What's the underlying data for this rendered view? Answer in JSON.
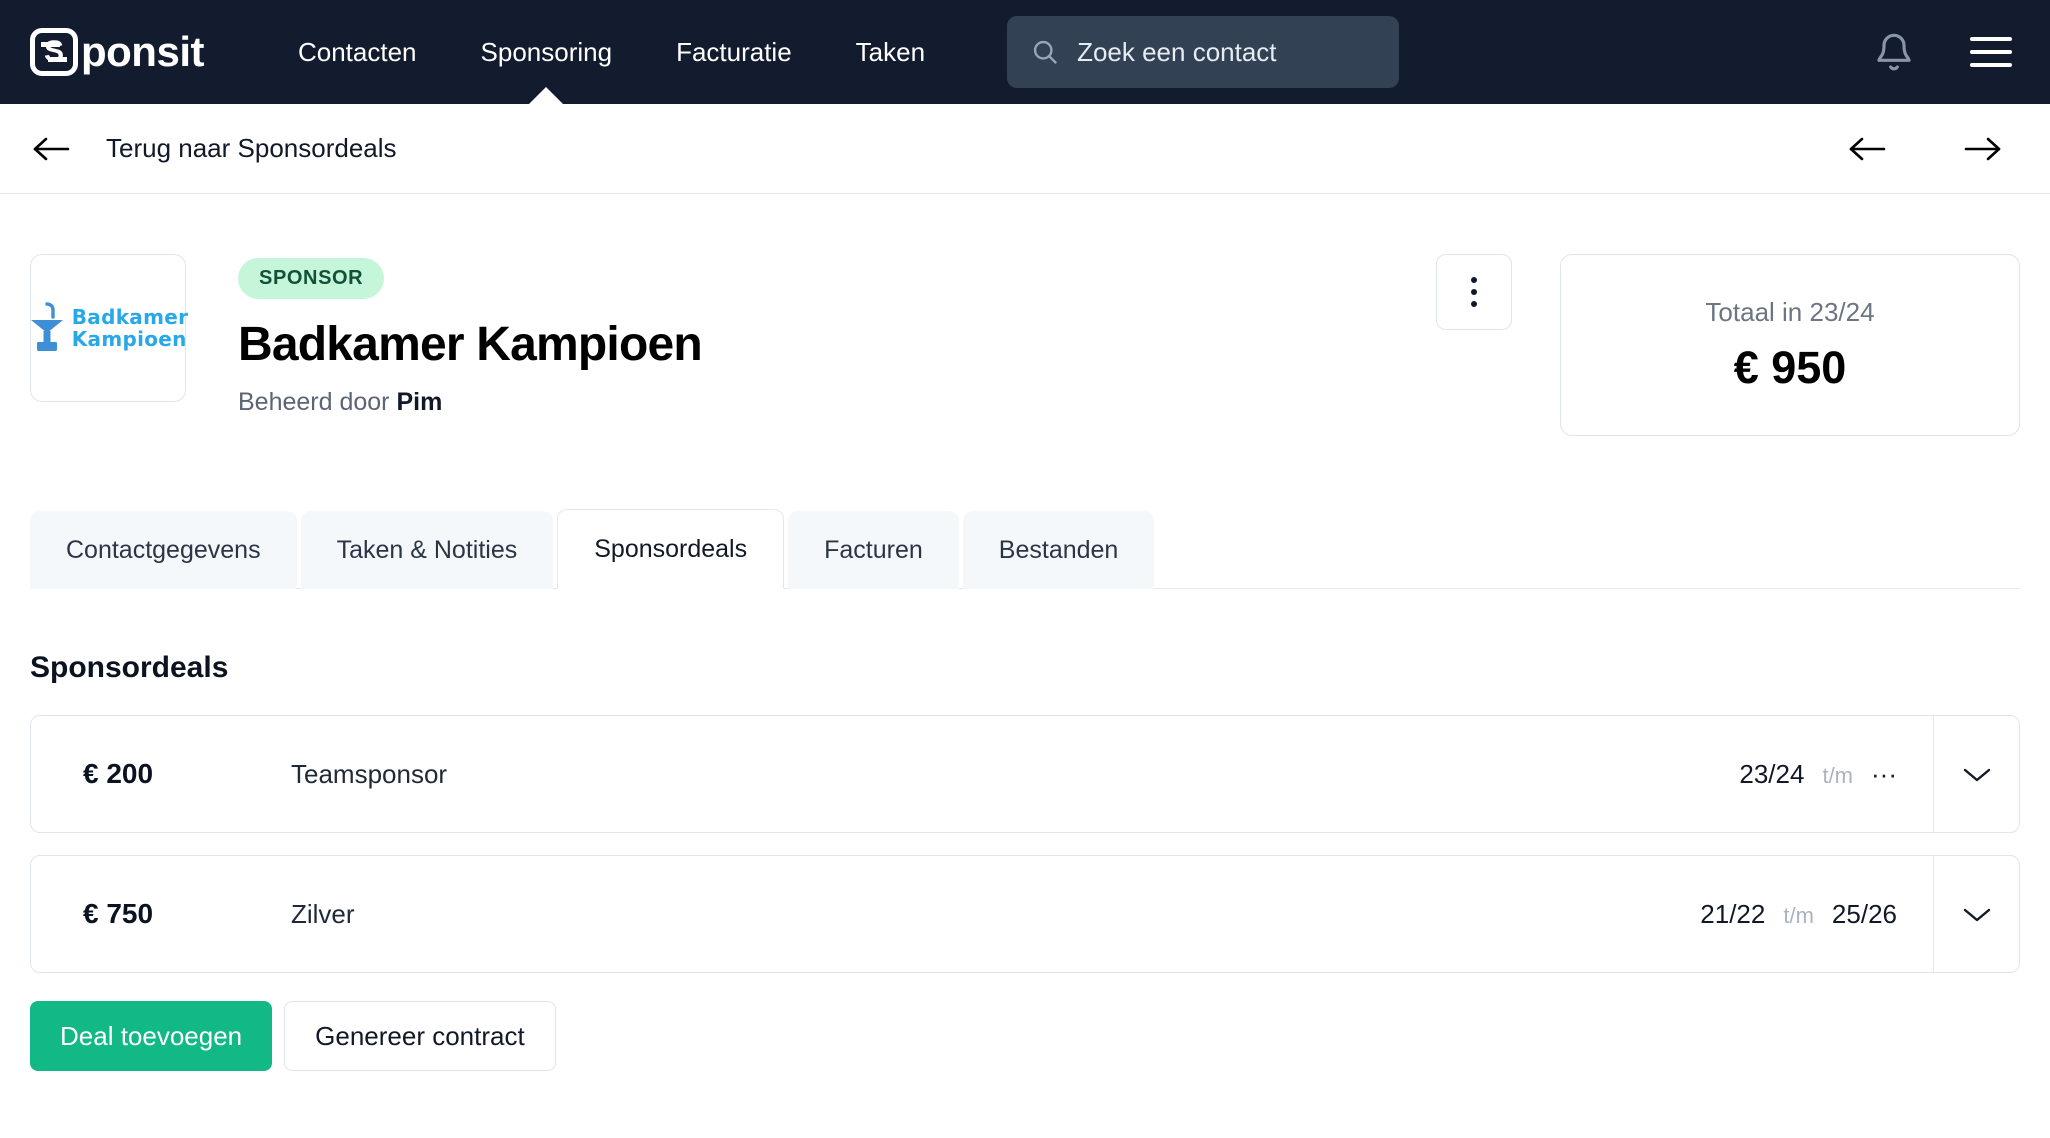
{
  "navbar": {
    "brand": {
      "mark_letter": "S",
      "text": "ponsit"
    },
    "links": [
      {
        "label": "Contacten",
        "active": false
      },
      {
        "label": "Sponsoring",
        "active": true
      },
      {
        "label": "Facturatie",
        "active": false
      },
      {
        "label": "Taken",
        "active": false
      }
    ],
    "search": {
      "placeholder": "Zoek een contact",
      "value": ""
    },
    "bell_icon": "bell-icon",
    "menu_icon": "hamburger-icon",
    "background_color": "#131c2e",
    "search_background": "#334155"
  },
  "backbar": {
    "back_label": "Terug naar Sponsordeals",
    "prev_icon": "arrow-left-icon",
    "next_icon": "arrow-right-icon"
  },
  "header": {
    "logo": {
      "line1": "Badkamer",
      "line2": "Kampioen",
      "icon": "sink-icon",
      "color": "#29a8e8"
    },
    "badge": "SPONSOR",
    "badge_bg": "#c6f6d9",
    "badge_color": "#12503a",
    "company_name": "Badkamer Kampioen",
    "managed_by_prefix": "Beheerd door ",
    "managed_by_name": "Pim",
    "kebab_icon": "more-vertical-icon",
    "total_label": "Totaal in 23/24",
    "total_value": "€ 950"
  },
  "tabs": [
    {
      "label": "Contactgegevens",
      "active": false
    },
    {
      "label": "Taken & Notities",
      "active": false
    },
    {
      "label": "Sponsordeals",
      "active": true
    },
    {
      "label": "Facturen",
      "active": false
    },
    {
      "label": "Bestanden",
      "active": false
    }
  ],
  "section": {
    "title": "Sponsordeals",
    "period_separator": "t/m",
    "deals": [
      {
        "amount": "€ 200",
        "name": "Teamsponsor",
        "period_start": "23/24",
        "period_end": "···",
        "toggle_icon": "chevron-down-icon"
      },
      {
        "amount": "€ 750",
        "name": "Zilver",
        "period_start": "21/22",
        "period_end": "25/26",
        "toggle_icon": "chevron-down-icon"
      }
    ]
  },
  "actions": {
    "primary_label": "Deal toevoegen",
    "primary_color": "#12b886",
    "secondary_label": "Genereer contract"
  }
}
